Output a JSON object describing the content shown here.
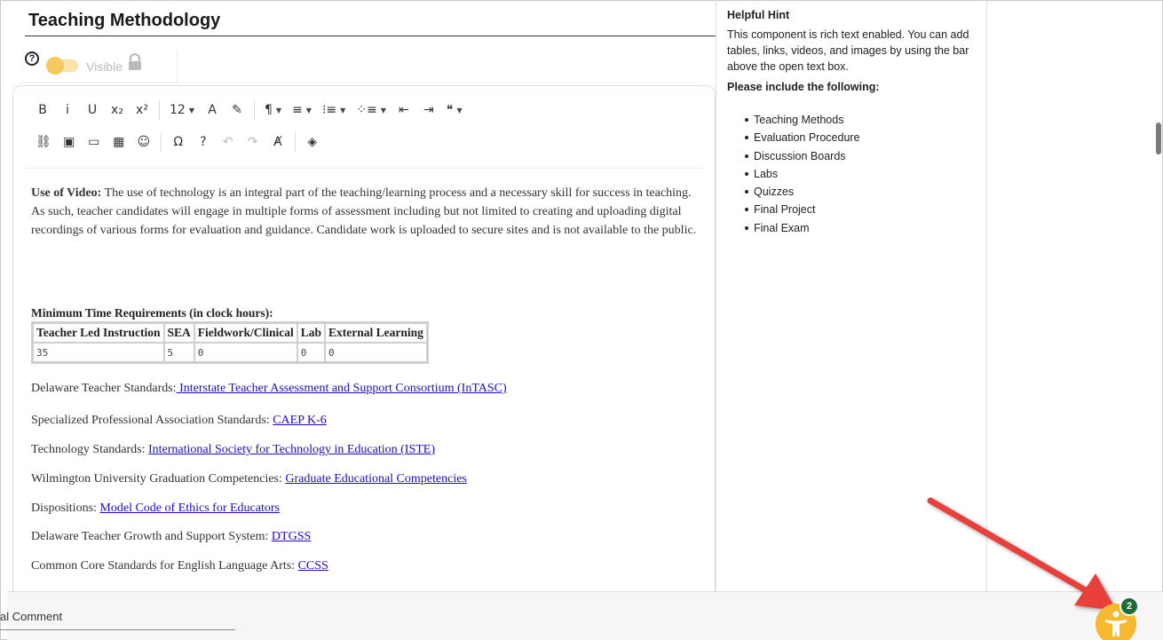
{
  "section": {
    "title": "Teaching Methodology",
    "visible_label": "Visible"
  },
  "toolbar": {
    "row1": [
      {
        "name": "bold-button",
        "glyph": "B"
      },
      {
        "name": "italic-button",
        "glyph": "i"
      },
      {
        "name": "underline-button",
        "glyph": "U"
      },
      {
        "name": "subscript-button",
        "glyph": "x₂"
      },
      {
        "name": "superscript-button",
        "glyph": "x²"
      },
      {
        "name": "font-size-select",
        "glyph": "12"
      },
      {
        "name": "text-color-icon",
        "glyph": "A"
      },
      {
        "name": "highlight-icon",
        "glyph": "✎"
      },
      {
        "name": "paragraph-format-icon",
        "glyph": "¶"
      },
      {
        "name": "align-icon",
        "glyph": "≡"
      },
      {
        "name": "ordered-list-icon",
        "glyph": "⁝≡"
      },
      {
        "name": "unordered-list-icon",
        "glyph": "⁘≡"
      },
      {
        "name": "outdent-icon",
        "glyph": "⇤"
      },
      {
        "name": "indent-icon",
        "glyph": "⇥"
      },
      {
        "name": "quote-icon",
        "glyph": "❝"
      }
    ],
    "font_size": "12",
    "row2": [
      {
        "name": "link-icon",
        "glyph": "⛓"
      },
      {
        "name": "image-icon",
        "glyph": "▣"
      },
      {
        "name": "video-icon",
        "glyph": "▭"
      },
      {
        "name": "table-icon",
        "glyph": "▦"
      },
      {
        "name": "emoji-icon",
        "glyph": "☺"
      },
      {
        "name": "special-char-icon",
        "glyph": "Ω"
      },
      {
        "name": "help-icon",
        "glyph": "?"
      },
      {
        "name": "undo-icon",
        "glyph": "↶"
      },
      {
        "name": "redo-icon",
        "glyph": "↷"
      },
      {
        "name": "clear-format-icon",
        "glyph": "Ⱥ"
      },
      {
        "name": "source-icon",
        "glyph": "◈"
      }
    ]
  },
  "content": {
    "video_label": "Use of Video:",
    "video_text": " The use of technology is an integral part of the teaching/learning process and a necessary skill for success in teaching. As such, teacher candidates will engage in multiple forms of assessment including but not limited to creating and uploading digital recordings of various forms for evaluation and guidance. Candidate work is uploaded to secure sites and is not available to the public.",
    "table_title": "Minimum Time Requirements (in clock hours):",
    "table_headers": [
      "Teacher Led Instruction",
      "SEA",
      "Fieldwork/Clinical",
      "Lab",
      "External Learning"
    ],
    "table_values": [
      "35",
      "5",
      "0",
      "0",
      "0"
    ],
    "standards": [
      {
        "label": "Delaware Teacher Standards:",
        "link": " Interstate Teacher Assessment and Support Consortium (InTASC) "
      },
      {
        "label": "Specialized Professional Association Standards: ",
        "link": "CAEP K-6"
      },
      {
        "label": "Technology Standards: ",
        "link": "International Society for Technology in Education (ISTE)"
      },
      {
        "label": "Wilmington University Graduation Competencies: ",
        "link": "Graduate Educational Competencies"
      },
      {
        "label": "Dispositions: ",
        "link": "Model Code of Ethics for Educators"
      },
      {
        "label": "Delaware Teacher Growth and Support System: ",
        "link": "DTGSS"
      },
      {
        "label": "Common Core Standards for English Language Arts: ",
        "link": "CCSS"
      }
    ]
  },
  "hint": {
    "title": "Helpful Hint",
    "text": "This component is rich text enabled. You can add tables, links, videos, and images by using the bar above the open text box.",
    "subtitle": "Please include the following:",
    "items": [
      "Teaching Methods",
      "Evaluation Procedure",
      "Discussion Boards",
      "Labs",
      "Quizzes",
      "Final Project",
      "Final Exam"
    ]
  },
  "bottom": {
    "comment_label": "al Comment"
  },
  "accessibility": {
    "badge_count": "2",
    "button_color": "#f5b82e",
    "badge_color": "#1c6b38"
  },
  "annotation": {
    "arrow_color": "#e8413b"
  }
}
